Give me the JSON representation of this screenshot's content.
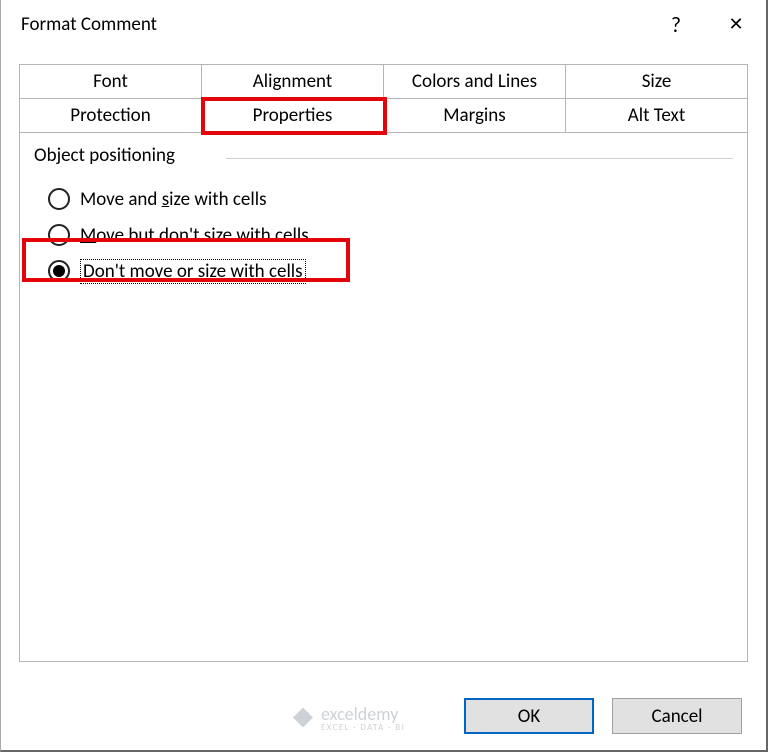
{
  "dialog": {
    "title": "Format Comment"
  },
  "titlebar": {
    "help": "?",
    "close": "✕"
  },
  "tabs": {
    "row1": {
      "font": "Font",
      "alignment": "Alignment",
      "colors": "Colors and Lines",
      "size": "Size"
    },
    "row2": {
      "protection": "Protection",
      "properties": "Properties",
      "margins": "Margins",
      "alttext": "Alt Text"
    }
  },
  "fieldset": {
    "legend": "Object positioning"
  },
  "radios": {
    "opt1_pre": "Move and ",
    "opt1_u": "s",
    "opt1_post": "ize with cells",
    "opt2_u": "M",
    "opt2_post": "ove but don't size with cells",
    "opt3_u": "D",
    "opt3_post": "on't move or size with cells"
  },
  "buttons": {
    "ok": "OK",
    "cancel": "Cancel"
  },
  "watermark": {
    "brand": "exceldemy",
    "sub": "EXCEL · DATA · BI"
  }
}
